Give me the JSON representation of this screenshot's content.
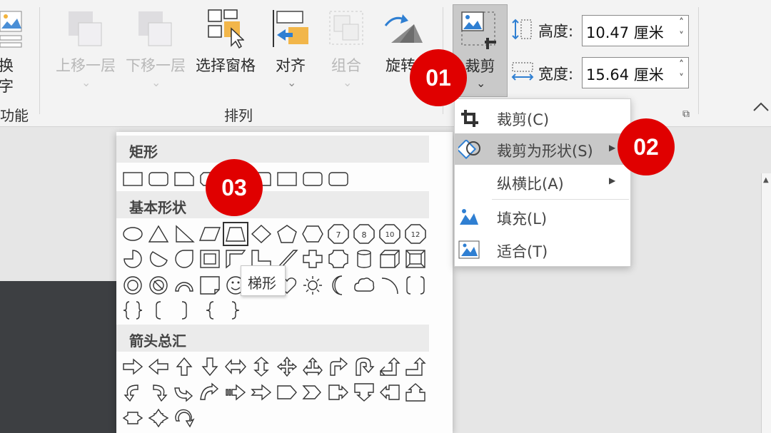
{
  "ribbon": {
    "partial": {
      "line1": "换",
      "line2": "字",
      "group": "功能"
    },
    "buttons": {
      "bring_forward": "上移一层",
      "send_backward": "下移一层",
      "selection_pane": "选择窗格",
      "align": "对齐",
      "group": "组合",
      "rotate": "旋转",
      "crop": "裁剪"
    },
    "arrange_group": "排列",
    "height": {
      "label": "高度:",
      "value": "10.47 厘米"
    },
    "width": {
      "label": "宽度:",
      "value": "15.64 厘米"
    }
  },
  "crop_menu": {
    "items": [
      {
        "label": "裁剪(C)",
        "icon": "crop-icon"
      },
      {
        "label": "裁剪为形状(S)",
        "icon": "crop-to-shape-icon",
        "submenu": true
      },
      {
        "label": "纵横比(A)",
        "icon": "",
        "submenu": true
      },
      {
        "label": "填充(L)",
        "icon": "fill-icon"
      },
      {
        "label": "适合(T)",
        "icon": "fit-icon"
      }
    ]
  },
  "shapes_panel": {
    "sections": {
      "rectangles": "矩形",
      "basic": "基本形状",
      "arrows": "箭头总汇"
    },
    "tooltip": "梯形",
    "octagon_numbers": [
      "7",
      "8",
      "10",
      "12"
    ]
  },
  "badges": [
    "01",
    "02",
    "03"
  ],
  "colors": {
    "badge": "#e00000",
    "ribbon_bg": "#f3f3f3",
    "menu_hover": "#c8c8c8"
  }
}
